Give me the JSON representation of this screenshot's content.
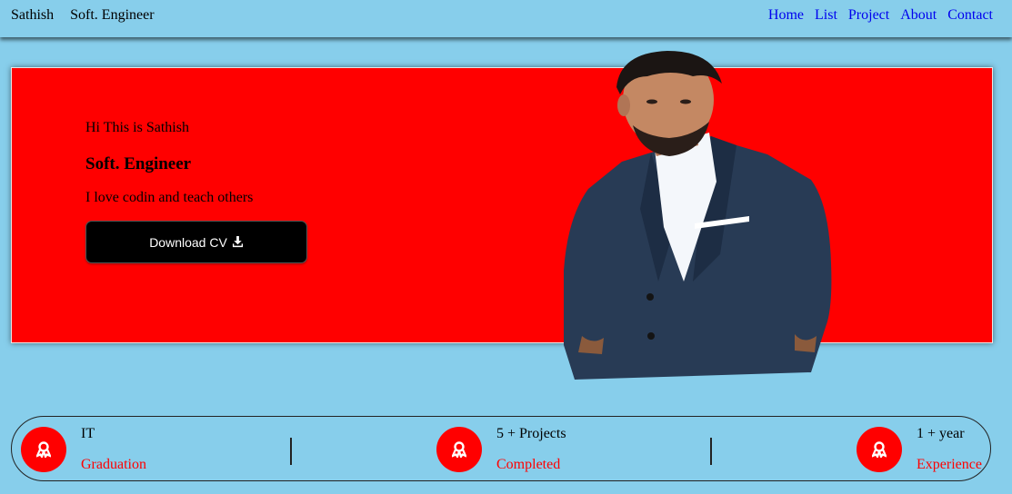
{
  "nav": {
    "brand_name": "Sathish",
    "brand_role": "Soft. Engineer",
    "links": [
      "Home",
      "List",
      "Project",
      "About",
      "Contact"
    ]
  },
  "hero": {
    "greeting": "Hi This is Sathish",
    "role": "Soft. Engineer",
    "tagline": "I love codin and teach others",
    "cv_button": "Download CV",
    "bg_color": "#ff0000"
  },
  "stats": [
    {
      "title": "IT",
      "subtitle": "Graduation"
    },
    {
      "title": "5 + Projects",
      "subtitle": "Completed"
    },
    {
      "title": "1 + year",
      "subtitle": "Experience"
    }
  ],
  "colors": {
    "page_bg": "#87ceeb",
    "accent": "#ff0000",
    "link": "#0000ee"
  }
}
